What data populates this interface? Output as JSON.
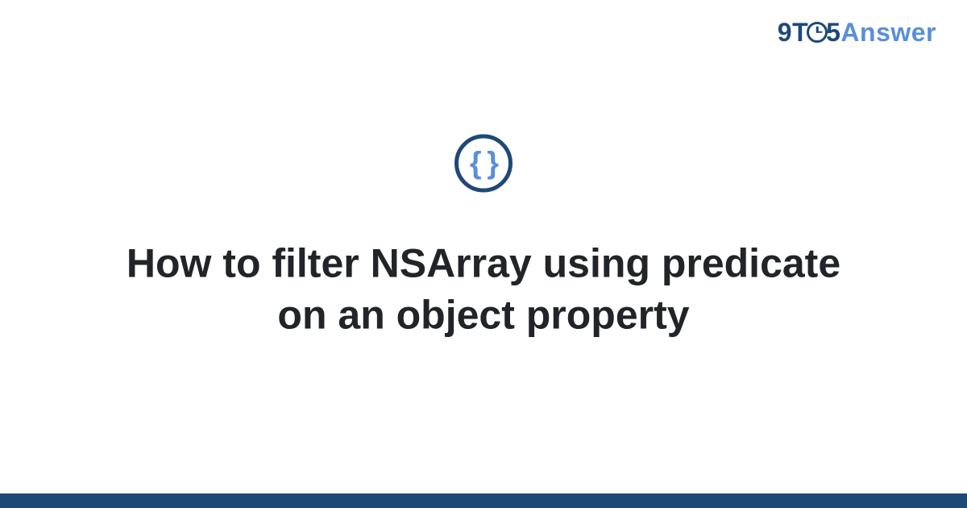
{
  "logo": {
    "part1": "9",
    "part2": "T",
    "part3": "5",
    "part4": "Answer"
  },
  "category": {
    "icon_name": "code-braces",
    "glyph": "{ }"
  },
  "title": "How to filter NSArray using predicate on an object property",
  "colors": {
    "dark_blue": "#1e4976",
    "light_blue": "#5a8fd8",
    "text": "#212529"
  }
}
